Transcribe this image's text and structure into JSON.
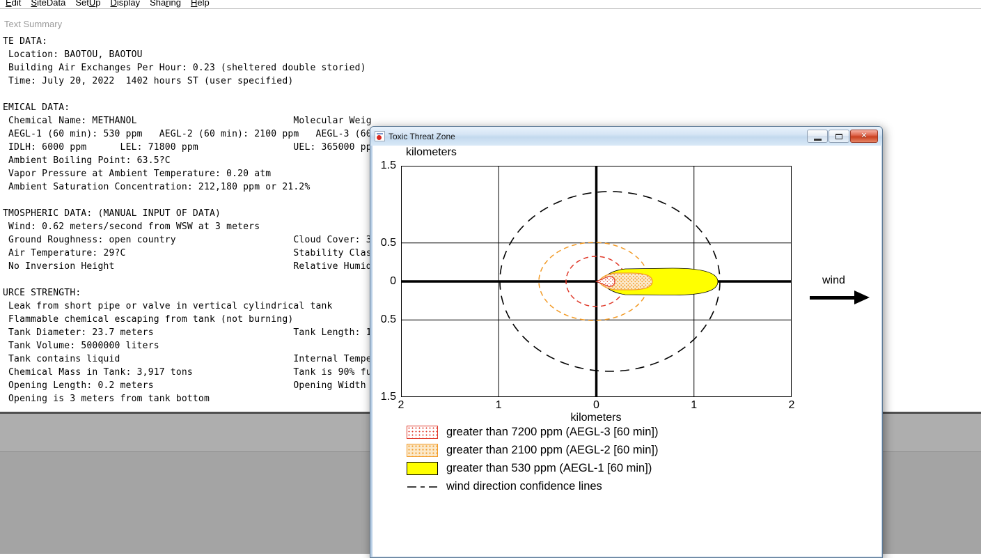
{
  "menu": {
    "items": [
      {
        "label": "Edit",
        "underline": 0
      },
      {
        "label": "SiteData",
        "underline": 0
      },
      {
        "label": "SetUp",
        "underline": 3
      },
      {
        "label": "Display",
        "underline": 0
      },
      {
        "label": "Sharing",
        "underline": 3
      },
      {
        "label": "Help",
        "underline": 0
      }
    ]
  },
  "text_summary": {
    "title": "Text Summary",
    "lines": [
      "TE DATA:",
      " Location: BAOTOU, BAOTOU",
      " Building Air Exchanges Per Hour: 0.23 (sheltered double storied)",
      " Time: July 20, 2022  1402 hours ST (user specified)",
      "",
      "EMICAL DATA:",
      " Chemical Name: METHANOL                            Molecular Weig",
      " AEGL-1 (60 min): 530 ppm   AEGL-2 (60 min): 2100 ppm   AEGL-3 (60",
      " IDLH: 6000 ppm      LEL: 71800 ppm                 UEL: 365000 pp",
      " Ambient Boiling Point: 63.5?C",
      " Vapor Pressure at Ambient Temperature: 0.20 atm",
      " Ambient Saturation Concentration: 212,180 ppm or 21.2%",
      "",
      "TMOSPHERIC DATA: (MANUAL INPUT OF DATA)",
      " Wind: 0.62 meters/second from WSW at 3 meters",
      " Ground Roughness: open country                     Cloud Cover: 3",
      " Air Temperature: 29?C                              Stability Clas",
      " No Inversion Height                                Relative Humid",
      "",
      "URCE STRENGTH:",
      " Leak from short pipe or valve in vertical cylindrical tank",
      " Flammable chemical escaping from tank (not burning)",
      " Tank Diameter: 23.7 meters                         Tank Length: 1",
      " Tank Volume: 5000000 liters",
      " Tank contains liquid                               Internal Tempe",
      " Chemical Mass in Tank: 3,917 tons                  Tank is 90% fu",
      " Opening Length: 0.2 meters                         Opening Width",
      " Opening is 3 meters from tank bottom"
    ]
  },
  "threat_window": {
    "title": "Toxic Threat Zone",
    "plot": {
      "y_axis_title": "kilometers",
      "x_axis_title": "kilometers",
      "y_ticks": [
        "1.5",
        "0.5",
        "0",
        "0.5",
        "1.5"
      ],
      "x_ticks": [
        "2",
        "1",
        "0",
        "1",
        "2"
      ],
      "wind_label": "wind"
    },
    "legend": [
      {
        "swatch": "aegl3",
        "label": "greater than 7200 ppm (AEGL-3 [60 min])"
      },
      {
        "swatch": "aegl2",
        "label": "greater than 2100 ppm (AEGL-2 [60 min])"
      },
      {
        "swatch": "aegl1",
        "label": "greater than 530 ppm (AEGL-1 [60 min])"
      },
      {
        "swatch": "confidence",
        "label": "wind direction confidence lines"
      }
    ],
    "colors": {
      "aegl3": "#e03a2b",
      "aegl2": "#f29a26",
      "aegl1": "#ffff00",
      "confidence_lines": "#000000"
    }
  },
  "chart_data": {
    "type": "area",
    "title": "Toxic Threat Zone",
    "xlabel": "kilometers",
    "ylabel": "kilometers",
    "xlim": [
      -2,
      2
    ],
    "ylim": [
      -1.5,
      1.5
    ],
    "x_tick_labels": [
      "2",
      "1",
      "0",
      "1",
      "2"
    ],
    "y_tick_labels": [
      "1.5",
      "0.5",
      "0",
      "0.5",
      "1.5"
    ],
    "grid": true,
    "legend_position": "bottom-left",
    "series": [
      {
        "name": "greater than 7200 ppm (AEGL-3 [60 min])",
        "threshold_ppm": 7200,
        "downwind_extent_km": 0.19,
        "max_half_width_km": 0.05,
        "color": "#e03a2b",
        "fill_style": "red stipple"
      },
      {
        "name": "greater than 2100 ppm (AEGL-2 [60 min])",
        "threshold_ppm": 2100,
        "downwind_extent_km": 0.58,
        "max_half_width_km": 0.12,
        "color": "#f29a26",
        "fill_style": "orange stipple"
      },
      {
        "name": "greater than 530 ppm (AEGL-1 [60 min])",
        "threshold_ppm": 530,
        "downwind_extent_km": 1.25,
        "max_half_width_km": 0.18,
        "color": "#ffff00",
        "fill_style": "solid yellow"
      }
    ],
    "confidence_circles_km": [
      0.32,
      0.56,
      1.16
    ],
    "wind": {
      "direction": "toward +x",
      "label": "wind"
    }
  }
}
